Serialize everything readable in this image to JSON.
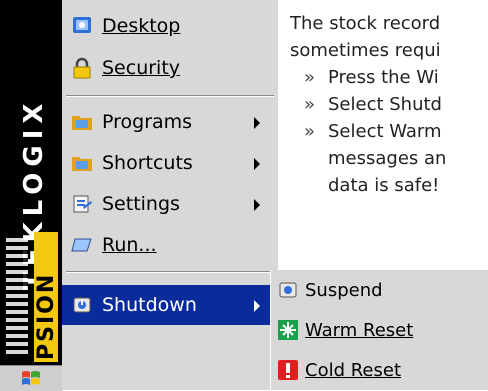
{
  "brand": {
    "vertical_text": "TEKLOGIX",
    "sub_text": "PSION"
  },
  "start_menu": {
    "items": [
      {
        "label": "Desktop",
        "mnemonic_index": 0,
        "icon": "desktop-icon",
        "has_submenu": false
      },
      {
        "label": "Security",
        "mnemonic_index": 0,
        "icon": "lock-icon",
        "has_submenu": false
      },
      {
        "label": "Programs",
        "mnemonic_index": 2,
        "icon": "folder-icon",
        "has_submenu": true
      },
      {
        "label": "Shortcuts",
        "mnemonic_index": 5,
        "icon": "folder-icon",
        "has_submenu": true
      },
      {
        "label": "Settings",
        "mnemonic_index": 5,
        "icon": "settings-icon",
        "has_submenu": true
      },
      {
        "label": "Run...",
        "mnemonic_index": 0,
        "icon": "run-icon",
        "has_submenu": false
      },
      {
        "label": "Shutdown",
        "mnemonic_index": 2,
        "icon": "shutdown-icon",
        "has_submenu": true,
        "selected": true
      }
    ]
  },
  "shutdown_submenu": {
    "items": [
      {
        "label": "Suspend",
        "mnemonic_index": 1,
        "icon": "suspend-icon"
      },
      {
        "label": "Warm Reset",
        "mnemonic_index": 0,
        "icon": "warm-reset-icon"
      },
      {
        "label": "Cold Reset",
        "mnemonic_index": 0,
        "icon": "cold-reset-icon"
      }
    ]
  },
  "article": {
    "intro_line1": "The stock record",
    "intro_line2": "sometimes requi",
    "bullets": [
      "Press the Wi",
      "Select Shutd",
      "Select Warm"
    ],
    "continuation_line1": "messages an",
    "continuation_line2": "data is safe!",
    "bullet_glyph": "»"
  },
  "colors": {
    "menu_bg": "#d8d8d8",
    "selection": "#0a2b9c",
    "brand_yellow": "#f2c811"
  }
}
